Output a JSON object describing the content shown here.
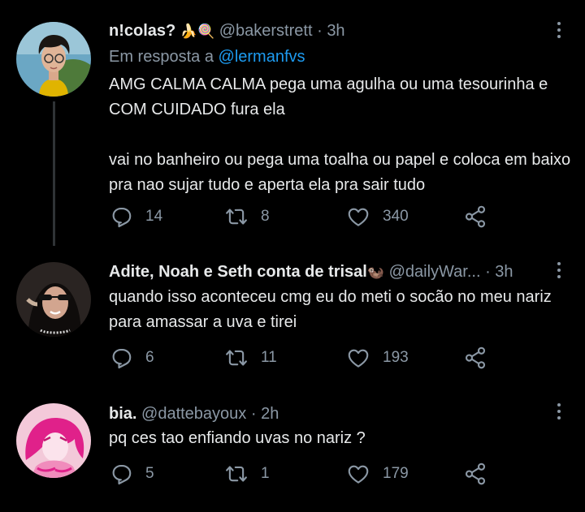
{
  "tweets": [
    {
      "name": "n!colas?",
      "badges": "🍌🍭",
      "handle": "@bakerstrett",
      "separator": "·",
      "time": "3h",
      "reply_prefix": "Em resposta a",
      "reply_mention": "@lermanfvs",
      "text": "AMG CALMA CALMA pega uma agulha ou uma tesourinha e COM CUIDADO fura ela\n\nvai no banheiro ou pega uma toalha ou papel e coloca em baixo pra nao sujar tudo e aperta ela pra sair tudo",
      "replies": "14",
      "retweets": "8",
      "likes": "340"
    },
    {
      "name": "Adite, Noah e Seth conta de trisal",
      "badges": "🦦",
      "handle": "@dailyWar...",
      "separator": "·",
      "time": "3h",
      "text": "quando isso aconteceu cmg eu do meti o socão no meu nariz para amassar a uva e tirei",
      "replies": "6",
      "retweets": "11",
      "likes": "193"
    },
    {
      "name": "bia.",
      "handle": "@dattebayoux",
      "separator": "·",
      "time": "2h",
      "text": "pq ces tao enfiando uvas no nariz ?",
      "replies": "5",
      "retweets": "1",
      "likes": "179"
    }
  ],
  "colors": {
    "background": "#000000",
    "text": "#e7e9ea",
    "muted": "#8b98a5",
    "link": "#1d9bf0"
  },
  "icons": [
    "reply-icon",
    "retweet-icon",
    "like-icon",
    "share-icon",
    "more-icon"
  ]
}
